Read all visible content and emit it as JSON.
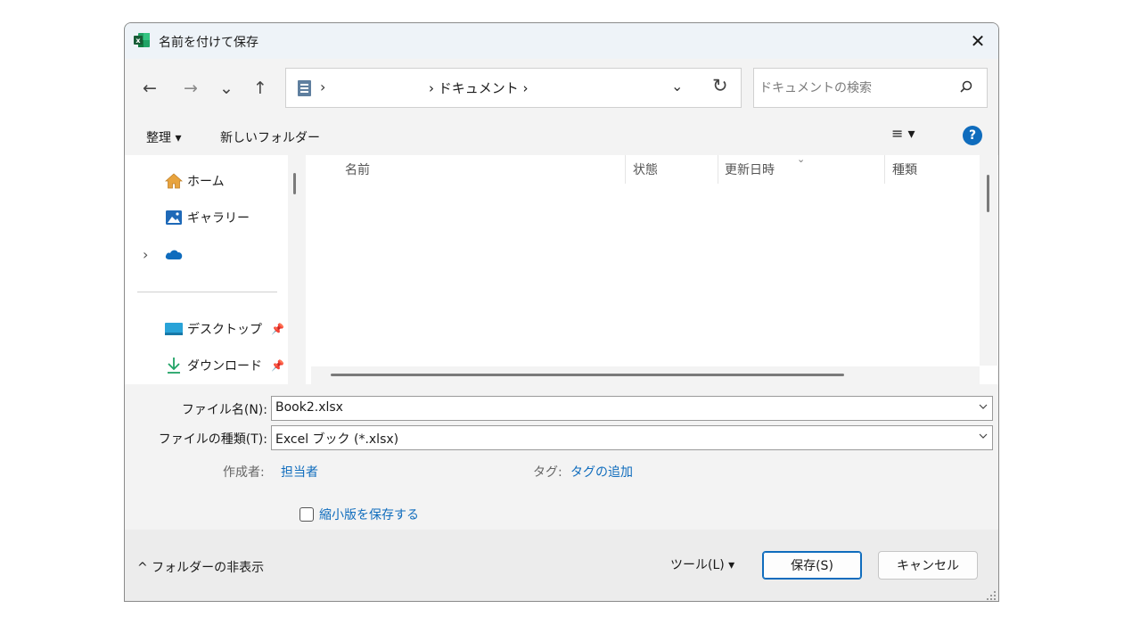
{
  "window": {
    "title": "名前を付けて保存",
    "close_glyph": "✕"
  },
  "nav": {
    "back": "←",
    "forward": "→",
    "recent": "⌄",
    "up": "↑"
  },
  "address": {
    "sep": "›",
    "crumb": "› ドキュメント ›",
    "dropdown": "⌄",
    "refresh": "↻"
  },
  "search": {
    "placeholder": "ドキュメントの検索"
  },
  "toolbar": {
    "organize": "整理 ▾",
    "new_folder": "新しいフォルダー",
    "view": "≡ ▾",
    "help": "?"
  },
  "sidebar": {
    "items": [
      {
        "label": "ホーム",
        "icon": "home-icon"
      },
      {
        "label": "ギャラリー",
        "icon": "gallery-icon"
      },
      {
        "label": "",
        "icon": "onedrive-cloud-icon",
        "expander": "›"
      },
      {
        "label": "デスクトップ",
        "icon": "desktop-folder-icon"
      },
      {
        "label": "ダウンロード",
        "icon": "download-icon"
      }
    ]
  },
  "filelist": {
    "columns": [
      "名前",
      "状態",
      "更新日時",
      "種類"
    ],
    "sort_indicator": "⌄"
  },
  "form": {
    "filename_label": "ファイル名(N):",
    "filename_value": "Book2.xlsx",
    "filetype_label": "ファイルの種類(T):",
    "filetype_value": "Excel ブック (*.xlsx)",
    "authors_label": "作成者:",
    "authors_value": "担当者",
    "tags_label": "タグ:",
    "tags_value": "タグの追加",
    "thumbnail_label": "縮小版を保存する"
  },
  "footer": {
    "hide_folders": "^ フォルダーの非表示",
    "tools": "ツール(L)  ▾",
    "save": "保存(S)",
    "cancel": "キャンセル"
  },
  "colors": {
    "accent": "#0f6cbd",
    "excel_green": "#1e7145"
  }
}
